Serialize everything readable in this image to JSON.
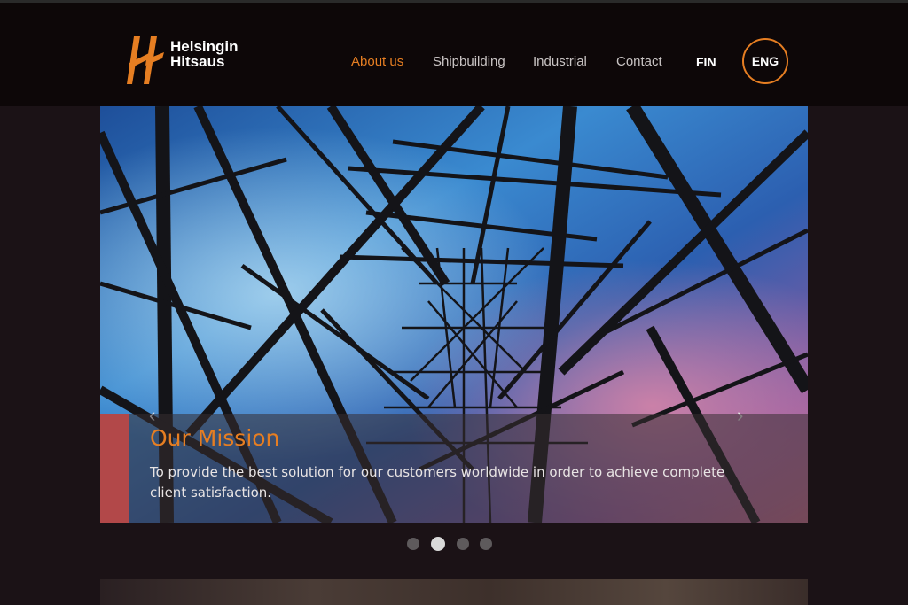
{
  "brand": {
    "line1": "Helsingin",
    "line2": "Hitsaus",
    "accent": "#e67e22"
  },
  "nav": {
    "items": [
      {
        "label": "About us",
        "active": true
      },
      {
        "label": "Shipbuilding",
        "active": false
      },
      {
        "label": "Industrial",
        "active": false
      },
      {
        "label": "Contact",
        "active": false
      }
    ],
    "lang_fin": "FIN",
    "lang_eng": "ENG"
  },
  "slider": {
    "prev_icon": "chevron-left-icon",
    "next_icon": "chevron-right-icon",
    "caption_title": "Our Mission",
    "caption_text": "To provide the best solution for our customers worldwide in order to achieve complete client satisfaction.",
    "dots_count": 4,
    "active_dot": 2
  },
  "colors": {
    "caption_bar": "#b24849",
    "background": "#1b1216",
    "header": "#0d0708"
  }
}
